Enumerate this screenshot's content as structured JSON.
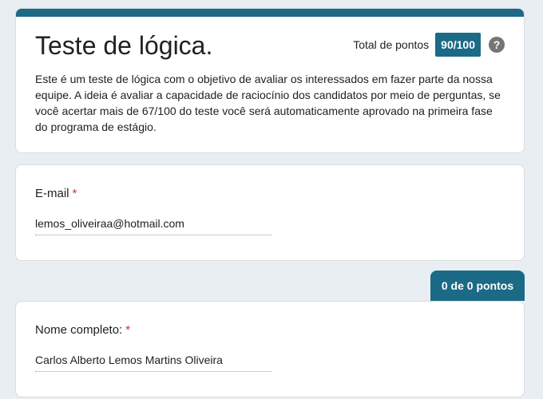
{
  "form": {
    "title": "Teste de lógica.",
    "total_points_label": "Total de pontos",
    "total_points_value": "90/100",
    "help_glyph": "?",
    "description": "Este é um teste de lógica com o objetivo de avaliar os interessados em fazer parte da nossa equipe. A ideia é avaliar a capacidade de raciocínio dos candidatos por meio de perguntas, se você acertar mais de 67/100 do teste você será automaticamente aprovado na primeira fase do programa de estágio."
  },
  "email": {
    "label": "E-mail",
    "required_mark": "*",
    "value": "lemos_oliveiraa@hotmail.com"
  },
  "section": {
    "points": "0 de 0 pontos"
  },
  "name": {
    "label": "Nome completo:",
    "required_mark": "*",
    "value": "Carlos Alberto Lemos Martins Oliveira"
  },
  "colors": {
    "accent": "#1b6a86",
    "background": "#e8eef1",
    "required": "#d93025"
  },
  "icons": {
    "help": "help-circle-icon"
  }
}
